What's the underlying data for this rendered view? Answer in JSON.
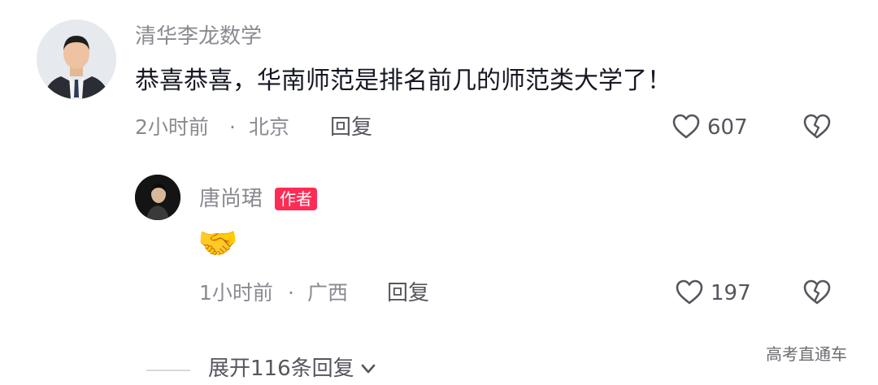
{
  "comment": {
    "username": "清华李龙数学",
    "text": "恭喜恭喜，华南师范是排名前几的师范类大学了！",
    "time": "2小时前",
    "separator": "·",
    "location": "北京",
    "reply_label": "回复",
    "like_count": "607"
  },
  "reply": {
    "username": "唐尚珺",
    "badge": "作者",
    "emoji": "🤝",
    "time": "1小时前",
    "separator": "·",
    "location": "广西",
    "reply_label": "回复",
    "like_count": "197"
  },
  "expand": {
    "label": "展开116条回复"
  },
  "watermark": "高考直通车",
  "colors": {
    "accent": "#fe2c55",
    "secondary_text": "#8a8b91"
  }
}
